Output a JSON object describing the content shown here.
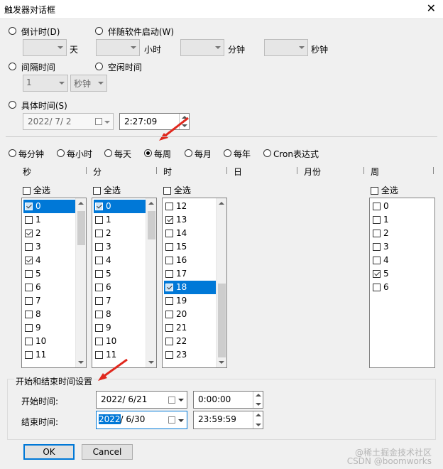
{
  "window": {
    "title": "触发器对话框",
    "close_icon": "close-icon"
  },
  "top": {
    "countdown": {
      "label": "倒计时(D)",
      "units": [
        "天",
        "小时",
        "分钟",
        "秒钟"
      ]
    },
    "with_software": {
      "label": "伴随软件启动(W)"
    },
    "interval": {
      "label": "间隔时间",
      "value": "1",
      "unit": "秒钟"
    },
    "idle": {
      "label": "空闲时间"
    },
    "specific": {
      "label": "具体时间(S)",
      "date": "2022/  7/  2",
      "time": "2:27:09"
    }
  },
  "freq": {
    "options": [
      "每分钟",
      "每小时",
      "每天",
      "每周",
      "每月",
      "每年",
      "Cron表达式"
    ],
    "selected": "每周"
  },
  "columns": [
    "秒",
    "分",
    "时",
    "日",
    "月份",
    "周"
  ],
  "select_all": "全选",
  "lists": {
    "sec": [
      {
        "v": "0",
        "c": true,
        "s": true
      },
      {
        "v": "1",
        "c": false
      },
      {
        "v": "2",
        "c": true
      },
      {
        "v": "3",
        "c": false
      },
      {
        "v": "4",
        "c": true
      },
      {
        "v": "5",
        "c": false
      },
      {
        "v": "6",
        "c": false
      },
      {
        "v": "7",
        "c": false
      },
      {
        "v": "8",
        "c": false
      },
      {
        "v": "9",
        "c": false
      },
      {
        "v": "10",
        "c": false
      },
      {
        "v": "11",
        "c": false
      }
    ],
    "min": [
      {
        "v": "0",
        "c": true,
        "s": true
      },
      {
        "v": "1",
        "c": false
      },
      {
        "v": "2",
        "c": false
      },
      {
        "v": "3",
        "c": false
      },
      {
        "v": "4",
        "c": false
      },
      {
        "v": "5",
        "c": false
      },
      {
        "v": "6",
        "c": false
      },
      {
        "v": "7",
        "c": false
      },
      {
        "v": "8",
        "c": false
      },
      {
        "v": "9",
        "c": false
      },
      {
        "v": "10",
        "c": false
      },
      {
        "v": "11",
        "c": false
      }
    ],
    "hour": [
      {
        "v": "12",
        "c": false
      },
      {
        "v": "13",
        "c": true
      },
      {
        "v": "14",
        "c": false
      },
      {
        "v": "15",
        "c": false
      },
      {
        "v": "16",
        "c": false
      },
      {
        "v": "17",
        "c": false
      },
      {
        "v": "18",
        "c": true,
        "s": true
      },
      {
        "v": "19",
        "c": false
      },
      {
        "v": "20",
        "c": false
      },
      {
        "v": "21",
        "c": false
      },
      {
        "v": "22",
        "c": false
      },
      {
        "v": "23",
        "c": false
      }
    ],
    "week": [
      {
        "v": "0",
        "c": false
      },
      {
        "v": "1",
        "c": false
      },
      {
        "v": "2",
        "c": false
      },
      {
        "v": "3",
        "c": false
      },
      {
        "v": "4",
        "c": false
      },
      {
        "v": "5",
        "c": true
      },
      {
        "v": "6",
        "c": false
      }
    ]
  },
  "range": {
    "group_label": "开始和结束时间设置",
    "start_label": "开始时间:",
    "start_date": "2022/  6/21",
    "start_time": "0:00:00",
    "end_label": "结束时间:",
    "end_date_year": "2022",
    "end_date_rest": "/  6/30",
    "end_time": "23:59:59"
  },
  "buttons": {
    "ok": "OK",
    "cancel": "Cancel"
  },
  "watermark": [
    "@稀土掘金技术社区",
    "CSDN @boomworks"
  ],
  "colors": {
    "selection": "#0078d7",
    "annotation_arrow": "#e0281e"
  }
}
